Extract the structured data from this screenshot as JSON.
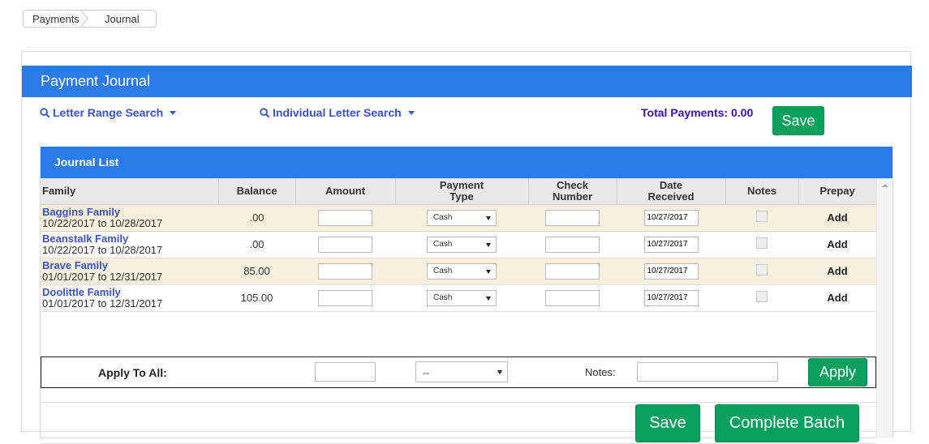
{
  "breadcrumb": {
    "items": [
      "Payments",
      "Journal"
    ]
  },
  "panel": {
    "title": "Payment Journal"
  },
  "toolbar": {
    "letter_range_search": "Letter Range Search",
    "individual_letter_search": "Individual Letter Search",
    "total_payments": "Total Payments: 0.00",
    "save_label": "Save"
  },
  "journal": {
    "title": "Journal List",
    "columns": {
      "family": "Family",
      "balance": "Balance",
      "amount": "Amount",
      "payment_type_1": "Payment",
      "payment_type_2": "Type",
      "check_1": "Check",
      "check_2": "Number",
      "date_1": "Date",
      "date_2": "Received",
      "notes": "Notes",
      "prepay": "Prepay"
    },
    "rows": [
      {
        "family": "Baggins Family",
        "dates": "10/22/2017 to 10/28/2017",
        "balance": ".00",
        "payment_type": "Cash",
        "date_received": "10/27/2017",
        "prepay": "Add"
      },
      {
        "family": "Beanstalk Family",
        "dates": "10/22/2017 to 10/28/2017",
        "balance": ".00",
        "payment_type": "Cash",
        "date_received": "10/27/2017",
        "prepay": "Add"
      },
      {
        "family": "Brave Family",
        "dates": "01/01/2017 to 12/31/2017",
        "balance": "85.00",
        "payment_type": "Cash",
        "date_received": "10/27/2017",
        "prepay": "Add"
      },
      {
        "family": "Doolittle Family",
        "dates": "01/01/2017 to 12/31/2017",
        "balance": "105.00",
        "payment_type": "Cash",
        "date_received": "10/27/2017",
        "prepay": "Add"
      }
    ],
    "apply_to_all": {
      "label": "Apply To All:",
      "payment_type": "--",
      "notes_label": "Notes:",
      "apply_button": "Apply"
    },
    "save_button": "Save",
    "complete_button": "Complete Batch"
  },
  "colors": {
    "header_blue": "#2b7bea",
    "link_blue": "#3a52d6",
    "total_purple": "#3e0fb1",
    "button_green": "#08a05d",
    "row_highlight": "#f6f0dc"
  }
}
